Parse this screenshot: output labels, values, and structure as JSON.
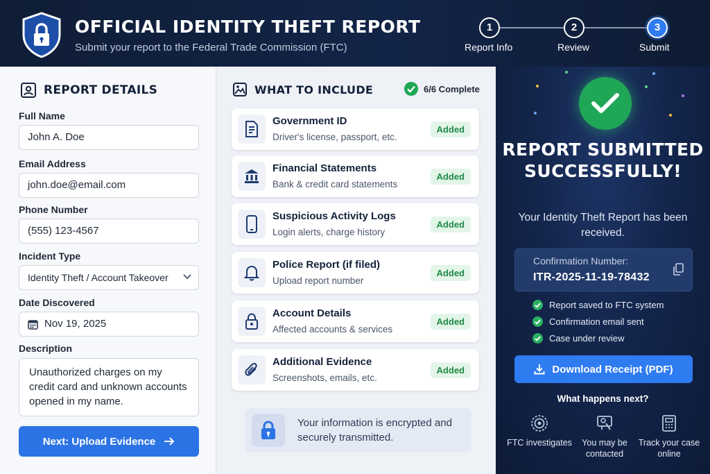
{
  "header": {
    "title": "OFFICIAL IDENTITY THEFT REPORT",
    "subtitle": "Submit your report to the Federal Trade Commission (FTC)",
    "steps": [
      {
        "number": "1",
        "label": "Report Info",
        "state": "done"
      },
      {
        "number": "2",
        "label": "Review",
        "state": "done"
      },
      {
        "number": "3",
        "label": "Submit",
        "state": "active"
      }
    ]
  },
  "report_details": {
    "title": "REPORT DETAILS",
    "fields": {
      "full_name": {
        "label": "Full Name",
        "value": "John A. Doe"
      },
      "email": {
        "label": "Email Address",
        "value": "john.doe@email.com"
      },
      "phone": {
        "label": "Phone Number",
        "value": "(555) 123-4567"
      },
      "incident_type": {
        "label": "Incident Type",
        "value": "Identity Theft / Account Takeover"
      },
      "date_discovered": {
        "label": "Date Discovered",
        "value": "Nov 19, 2025"
      },
      "description": {
        "label": "Description",
        "value": "Unauthorized charges on my credit card and unknown accounts opened in my name."
      }
    },
    "next_button": "Next: Upload Evidence"
  },
  "what_to_include": {
    "title": "WHAT TO INCLUDE",
    "complete_text": "6/6 Complete",
    "items": [
      {
        "title": "Government ID",
        "subtitle": "Driver's license, passport, etc.",
        "status": "Added",
        "icon": "document-icon"
      },
      {
        "title": "Financial Statements",
        "subtitle": "Bank & credit card statements",
        "status": "Added",
        "icon": "bank-icon"
      },
      {
        "title": "Suspicious Activity Logs",
        "subtitle": "Login alerts, charge history",
        "status": "Added",
        "icon": "phone-icon"
      },
      {
        "title": "Police Report (if filed)",
        "subtitle": "Upload report number",
        "status": "Added",
        "icon": "bell-icon"
      },
      {
        "title": "Account Details",
        "subtitle": "Affected accounts & services",
        "status": "Added",
        "icon": "lock-icon"
      },
      {
        "title": "Additional Evidence",
        "subtitle": "Screenshots, emails, etc.",
        "status": "Added",
        "icon": "paperclip-icon"
      }
    ],
    "secure_note": "Your information is encrypted and securely transmitted."
  },
  "confirmation": {
    "title": "REPORT SUBMITTED SUCCESSFULLY!",
    "subtitle": "Your Identity Theft Report has been received.",
    "number_label": "Confirmation Number:",
    "number": "ITR-2025-11-19-78432",
    "checks": [
      "Report saved to FTC system",
      "Confirmation email sent",
      "Case under review"
    ],
    "download_button": "Download Receipt (PDF)",
    "next_title": "What happens next?",
    "next_items": [
      {
        "label": "FTC investigates",
        "icon": "seal-icon"
      },
      {
        "label": "You may be contacted",
        "icon": "contact-icon"
      },
      {
        "label": "Track your case online",
        "icon": "tracker-icon"
      }
    ]
  },
  "colors": {
    "header_bg": "#0f1d36",
    "primary_blue": "#2c74e6",
    "success_green": "#1fa657",
    "panel_dark": "#13254b"
  }
}
